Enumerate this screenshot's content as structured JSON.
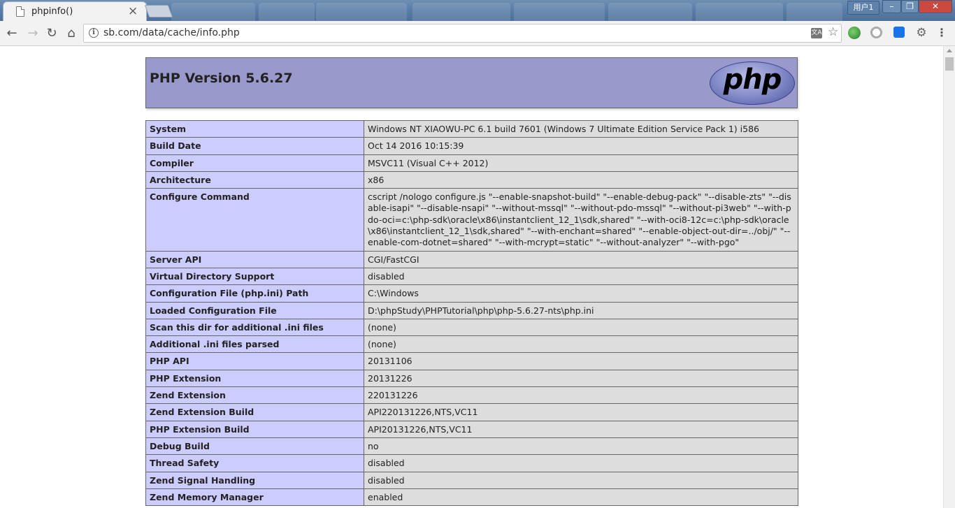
{
  "browser": {
    "tab_title": "phpinfo()",
    "tab_close": "×",
    "user_badge": "用户1",
    "url": "sb.com/data/cache/info.php"
  },
  "page": {
    "header_title": "PHP Version 5.6.27",
    "logo_text": "php",
    "rows": [
      {
        "key": "System",
        "value": "Windows NT XIAOWU-PC 6.1 build 7601 (Windows 7 Ultimate Edition Service Pack 1) i586"
      },
      {
        "key": "Build Date",
        "value": "Oct 14 2016 10:15:39"
      },
      {
        "key": "Compiler",
        "value": "MSVC11 (Visual C++ 2012)"
      },
      {
        "key": "Architecture",
        "value": "x86"
      },
      {
        "key": "Configure Command",
        "value": "cscript /nologo configure.js \"--enable-snapshot-build\" \"--enable-debug-pack\" \"--disable-zts\" \"--disable-isapi\" \"--disable-nsapi\" \"--without-mssql\" \"--without-pdo-mssql\" \"--without-pi3web\" \"--with-pdo-oci=c:\\php-sdk\\oracle\\x86\\instantclient_12_1\\sdk,shared\" \"--with-oci8-12c=c:\\php-sdk\\oracle\\x86\\instantclient_12_1\\sdk,shared\" \"--with-enchant=shared\" \"--enable-object-out-dir=../obj/\" \"--enable-com-dotnet=shared\" \"--with-mcrypt=static\" \"--without-analyzer\" \"--with-pgo\""
      },
      {
        "key": "Server API",
        "value": "CGI/FastCGI"
      },
      {
        "key": "Virtual Directory Support",
        "value": "disabled"
      },
      {
        "key": "Configuration File (php.ini) Path",
        "value": "C:\\Windows"
      },
      {
        "key": "Loaded Configuration File",
        "value": "D:\\phpStudy\\PHPTutorial\\php\\php-5.6.27-nts\\php.ini"
      },
      {
        "key": "Scan this dir for additional .ini files",
        "value": "(none)"
      },
      {
        "key": "Additional .ini files parsed",
        "value": "(none)"
      },
      {
        "key": "PHP API",
        "value": "20131106"
      },
      {
        "key": "PHP Extension",
        "value": "20131226"
      },
      {
        "key": "Zend Extension",
        "value": "220131226"
      },
      {
        "key": "Zend Extension Build",
        "value": "API220131226,NTS,VC11"
      },
      {
        "key": "PHP Extension Build",
        "value": "API20131226,NTS,VC11"
      },
      {
        "key": "Debug Build",
        "value": "no"
      },
      {
        "key": "Thread Safety",
        "value": "disabled"
      },
      {
        "key": "Zend Signal Handling",
        "value": "disabled"
      },
      {
        "key": "Zend Memory Manager",
        "value": "enabled"
      }
    ]
  }
}
